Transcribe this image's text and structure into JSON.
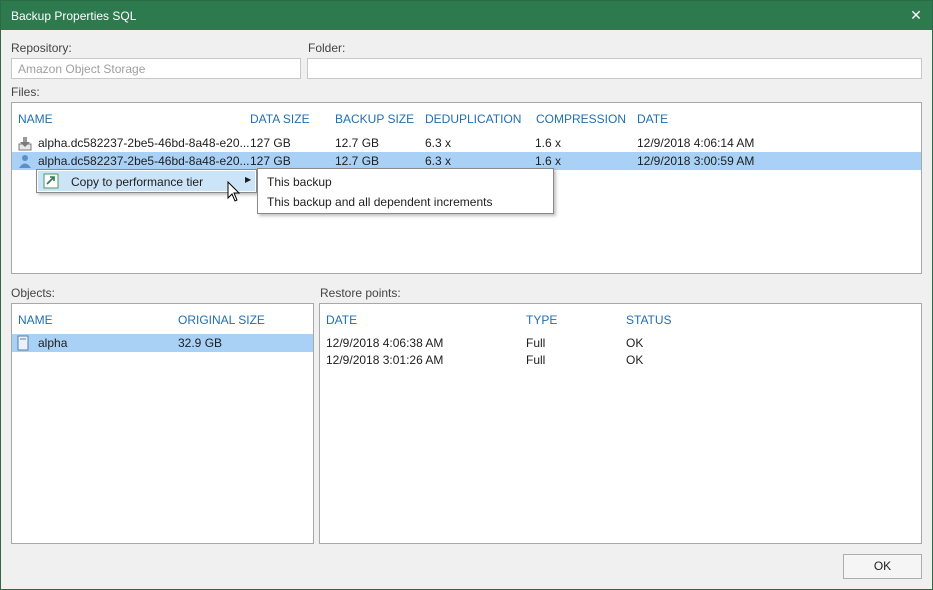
{
  "window": {
    "title": "Backup Properties SQL",
    "close_glyph": "✕"
  },
  "repository": {
    "label": "Repository:",
    "value": "Amazon Object Storage"
  },
  "folder": {
    "label": "Folder:",
    "value": ""
  },
  "files": {
    "label": "Files:",
    "columns": [
      "NAME",
      "DATA SIZE",
      "BACKUP SIZE",
      "DEDUPLICATION",
      "COMPRESSION",
      "DATE"
    ],
    "rows": [
      {
        "name": "alpha.dc582237-2be5-46bd-8a48-e20...",
        "data_size": "127 GB",
        "backup_size": "12.7 GB",
        "dedup": "6.3 x",
        "compression": "1.6 x",
        "date": "12/9/2018 4:06:14 AM",
        "icon": "backup-file-icon"
      },
      {
        "name": "alpha.dc582237-2be5-46bd-8a48-e20...",
        "data_size": "127 GB",
        "backup_size": "12.7 GB",
        "dedup": "6.3 x",
        "compression": "1.6 x",
        "date": "12/9/2018 3:00:59 AM",
        "icon": "backup-file-icon"
      }
    ]
  },
  "context_menu": {
    "item": "Copy to performance tier",
    "icon": "copy-to-tier-icon",
    "submenu": [
      "This backup",
      "This backup and all dependent increments"
    ]
  },
  "objects": {
    "label": "Objects:",
    "columns": [
      "NAME",
      "ORIGINAL SIZE"
    ],
    "rows": [
      {
        "name": "alpha",
        "size": "32.9 GB",
        "icon": "vm-object-icon"
      }
    ]
  },
  "restore_points": {
    "label": "Restore points:",
    "columns": [
      "DATE",
      "TYPE",
      "STATUS"
    ],
    "rows": [
      {
        "date": "12/9/2018 4:06:38 AM",
        "type": "Full",
        "status": "OK"
      },
      {
        "date": "12/9/2018 3:01:26 AM",
        "type": "Full",
        "status": "OK"
      }
    ]
  },
  "buttons": {
    "ok": "OK"
  },
  "colors": {
    "titlebar": "#2d7a4f",
    "header_text": "#1f6fb2",
    "selection": "#a9d0f5"
  }
}
